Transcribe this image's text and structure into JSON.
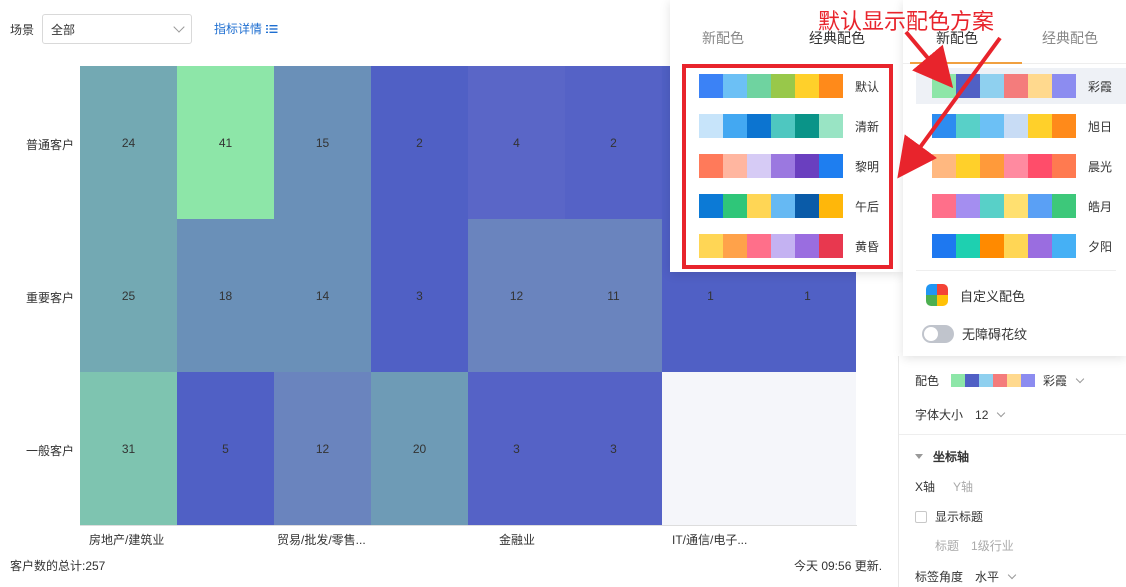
{
  "filter": {
    "label": "场景",
    "value": "全部"
  },
  "metric_link": {
    "label": "指标详情",
    "icon": "list-icon"
  },
  "chart_data": {
    "type": "heatmap",
    "rows": [
      "普通客户",
      "重要客户",
      "一般客户"
    ],
    "x_tick_labels": [
      "房地产/建筑业",
      "贸易/批发/零售...",
      "金融业",
      "IT/通信/电子..."
    ],
    "values": [
      [
        24,
        41,
        15,
        2,
        4,
        2,
        null,
        null
      ],
      [
        25,
        18,
        14,
        3,
        12,
        11,
        1,
        1
      ],
      [
        31,
        5,
        12,
        20,
        3,
        3,
        null,
        null
      ]
    ],
    "colors": [
      [
        "#73a9b3",
        "#8de6a8",
        "#6a90b8",
        "#5060c5",
        "#5a66c7",
        "#5562c6",
        "#5060c5",
        "#5060c5"
      ],
      [
        "#73a9b3",
        "#6a90b8",
        "#6a90b8",
        "#5060c5",
        "#6a84be",
        "#6a84be",
        "#5060c5",
        "#5060c5"
      ],
      [
        "#7ec4b0",
        "#5060c5",
        "#6a84be",
        "#6e9bb6",
        "#5562c6",
        "#5562c6",
        "#f5f6fa",
        "#f5f6fa"
      ]
    ]
  },
  "footer": {
    "total": "客户数的总计:257",
    "updated": "今天 09:56 更新."
  },
  "settings": {
    "color_label": "配色",
    "color_value": "彩霞",
    "color_swatch": [
      "#8de6a8",
      "#5060c5",
      "#8fd0ef",
      "#f47c7c",
      "#ffd98e",
      "#8c8cf0"
    ],
    "font_size_label": "字体大小",
    "font_size_value": "12",
    "axis_section": "坐标轴",
    "axis_x": "X轴",
    "axis_y": "Y轴",
    "show_title": "显示标题",
    "title_label": "标题",
    "title_value": "1级行业",
    "tick_angle_label": "标签角度",
    "tick_angle_value": "水平"
  },
  "popover_left": {
    "tabs": [
      "新配色",
      "经典配色"
    ],
    "active_tab": 1,
    "schemes": [
      {
        "name": "默认",
        "colors": [
          "#3b82f6",
          "#6cc0f5",
          "#6fd3a0",
          "#98c84a",
          "#ffd02a",
          "#ff8a1a"
        ]
      },
      {
        "name": "清新",
        "colors": [
          "#c7e4fa",
          "#43a8f2",
          "#0c74d0",
          "#4ec7c0",
          "#0a9488",
          "#99e4c4"
        ]
      },
      {
        "name": "黎明",
        "colors": [
          "#ff7a5a",
          "#ffb6a0",
          "#d6cbf5",
          "#9b78e0",
          "#6a3fbf",
          "#1e7ef0"
        ]
      },
      {
        "name": "午后",
        "colors": [
          "#0c7ad6",
          "#2fc679",
          "#ffd655",
          "#66b9f3",
          "#0a5ba8",
          "#ffb70a"
        ]
      },
      {
        "name": "黄昏",
        "colors": [
          "#ffd655",
          "#ffa24a",
          "#ff6f8a",
          "#c4b2f2",
          "#9a6de0",
          "#e8384f"
        ]
      }
    ]
  },
  "popover_right": {
    "tabs": [
      "新配色",
      "经典配色"
    ],
    "active_tab": 0,
    "schemes": [
      {
        "name": "彩霞",
        "colors": [
          "#8de6a8",
          "#5060c5",
          "#8fd0ef",
          "#f47c7c",
          "#ffd98e",
          "#8c8cf0"
        ]
      },
      {
        "name": "旭日",
        "colors": [
          "#2d8cf0",
          "#58d0c8",
          "#6cc0f5",
          "#c8dcf5",
          "#ffd02a",
          "#ff8a1a"
        ]
      },
      {
        "name": "晨光",
        "colors": [
          "#ffb880",
          "#ffd02a",
          "#ff9a3a",
          "#ff8aa0",
          "#ff4d6a",
          "#ff7a50"
        ]
      },
      {
        "name": "皓月",
        "colors": [
          "#ff6f8a",
          "#a48ef0",
          "#58d0c8",
          "#ffe070",
          "#5aa0f5",
          "#3dc87a"
        ]
      },
      {
        "name": "夕阳",
        "colors": [
          "#1e78f0",
          "#1ed0b0",
          "#ff8a00",
          "#ffd655",
          "#9a6de0",
          "#45b0f5"
        ]
      }
    ],
    "custom_label": "自定义配色",
    "accessible_label": "无障碍花纹"
  },
  "annotation": {
    "text": "默认显示配色方案",
    "color": "#e8242c"
  }
}
